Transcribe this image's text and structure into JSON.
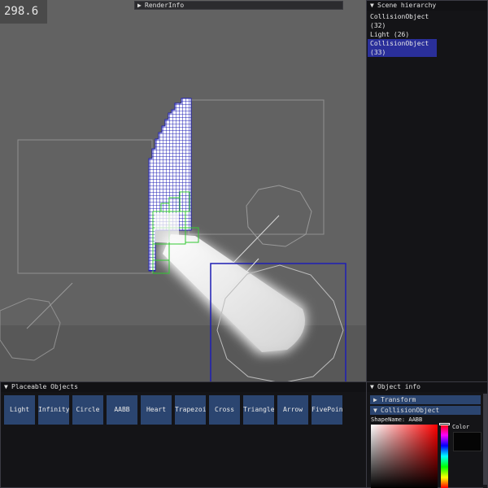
{
  "fps": "298.6",
  "render_info": {
    "title": "RenderInfo"
  },
  "hierarchy": {
    "title": "Scene hierarchy",
    "items": [
      {
        "label": "CollisionObject (32)",
        "selected": false
      },
      {
        "label": "Light (26)",
        "selected": false
      },
      {
        "label": "CollisionObject (33)",
        "selected": true
      }
    ]
  },
  "placeable": {
    "title": "Placeable Objects",
    "buttons": [
      "Light",
      "Infinity",
      "Circle",
      "AABB",
      "Heart",
      "Trapezoid",
      "Cross",
      "Triangle",
      "Arrow",
      "FivePoint"
    ]
  },
  "object_info": {
    "title": "Object info",
    "transform_label": "Transform",
    "collision_label": "CollisionObject",
    "shape_name": "ShapeName: AABB",
    "color_label": "Color",
    "color_value": "#050505"
  },
  "colors": {
    "selection": "#2a2f9a",
    "button": "#2b4570",
    "viewport_bg": "#626262",
    "grid_blue": "#1e1eb4",
    "grid_green": "#32c832"
  }
}
